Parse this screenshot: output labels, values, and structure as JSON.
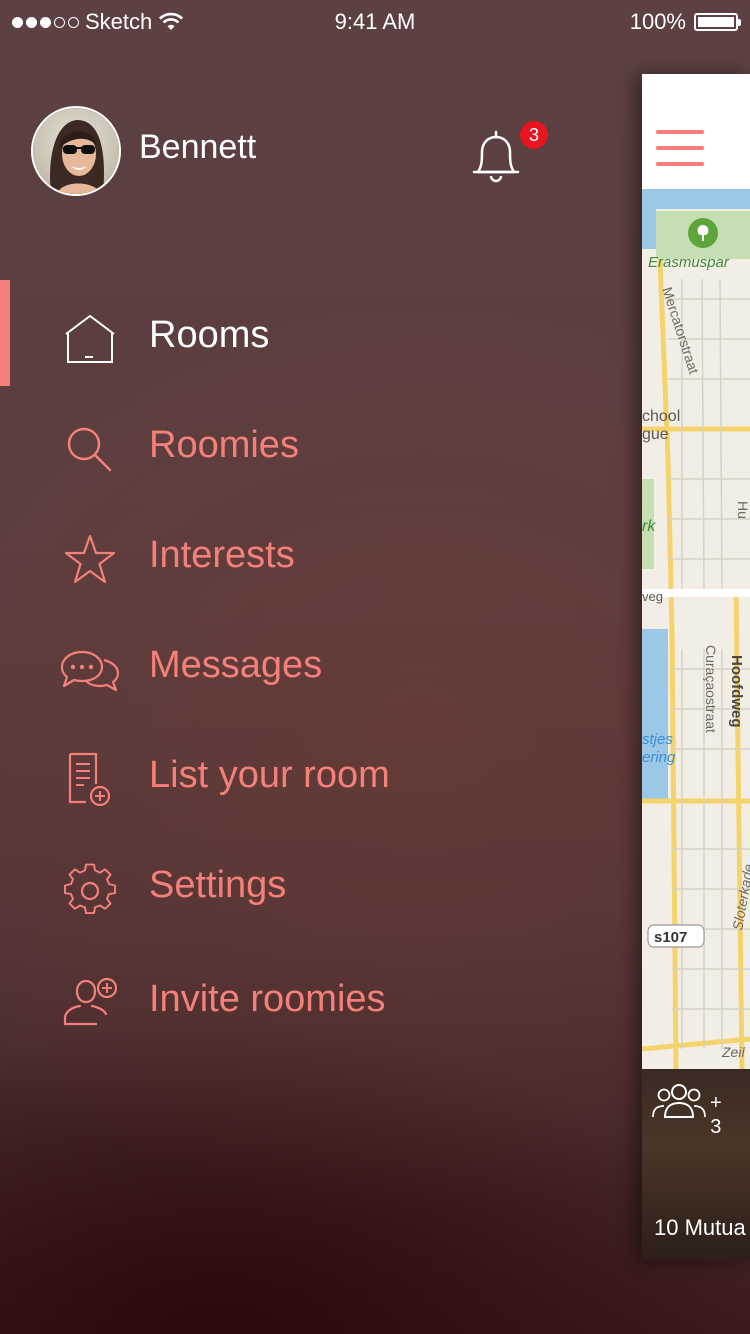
{
  "status_bar": {
    "carrier": "Sketch",
    "time": "9:41 AM",
    "battery": "100%"
  },
  "profile": {
    "name": "Bennett",
    "notification_count": "3"
  },
  "menu": {
    "items": [
      {
        "label": "Rooms",
        "icon": "home-icon",
        "active": true
      },
      {
        "label": "Roomies",
        "icon": "search-icon",
        "active": false
      },
      {
        "label": "Interests",
        "icon": "star-icon",
        "active": false
      },
      {
        "label": "Messages",
        "icon": "chat-icon",
        "active": false
      },
      {
        "label": "List your room",
        "icon": "add-document-icon",
        "active": false
      },
      {
        "label": "Settings",
        "icon": "gear-icon",
        "active": false
      },
      {
        "label": "Invite roomies",
        "icon": "add-user-icon",
        "active": false
      }
    ]
  },
  "map": {
    "labels": [
      "Erasmuspar",
      "Mercatorstraat",
      "chool",
      "gue",
      "rk",
      "veg",
      "Curaçaostraat",
      "Hoofdweg",
      "stjes",
      "ering",
      "s107",
      "Sloterkade",
      "Zeil",
      "Hu"
    ]
  },
  "card": {
    "plus_count": "+\n3",
    "mutual_text": "10 Mutua"
  },
  "colors": {
    "accent": "#f4807b",
    "badge": "#e8141f"
  }
}
